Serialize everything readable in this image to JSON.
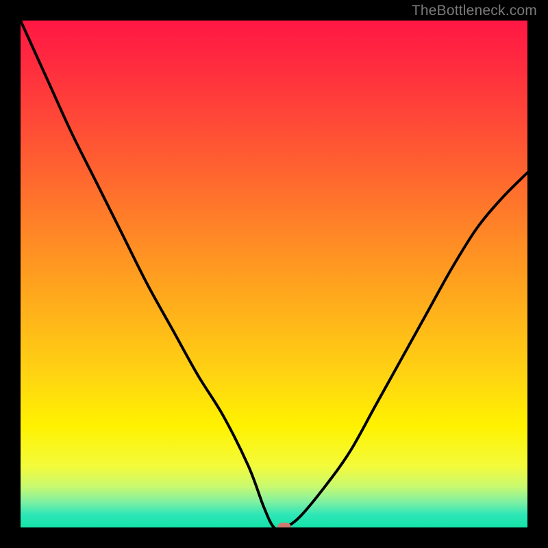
{
  "watermark": "TheBottleneck.com",
  "chart_data": {
    "type": "line",
    "title": "",
    "xlabel": "",
    "ylabel": "",
    "xlim": [
      0,
      100
    ],
    "ylim": [
      0,
      100
    ],
    "grid": false,
    "series": [
      {
        "name": "curve",
        "x": [
          0,
          5,
          10,
          15,
          20,
          25,
          30,
          35,
          40,
          45,
          48,
          50,
          52,
          55,
          60,
          65,
          70,
          75,
          80,
          85,
          90,
          95,
          100
        ],
        "y": [
          100,
          89,
          78,
          68,
          58,
          48,
          39,
          30,
          22,
          12,
          4,
          0,
          0,
          2,
          8,
          15,
          24,
          33,
          42,
          51,
          59,
          65,
          70
        ]
      }
    ],
    "marker": {
      "x": 52,
      "y": 0,
      "shape": "pill",
      "color": "#cf7a70"
    },
    "background_gradient": {
      "type": "vertical",
      "stops": [
        {
          "pos": 0.0,
          "color": "#ff1744"
        },
        {
          "pos": 0.45,
          "color": "#ff8f24"
        },
        {
          "pos": 0.8,
          "color": "#fff200"
        },
        {
          "pos": 1.0,
          "color": "#14e3a8"
        }
      ]
    }
  }
}
